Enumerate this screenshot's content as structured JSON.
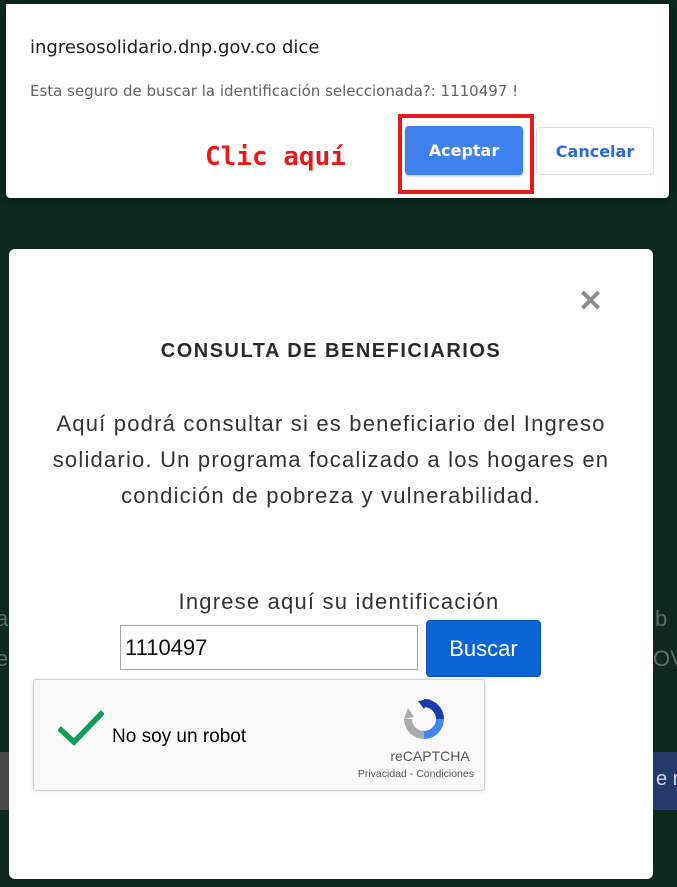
{
  "background": {
    "left_fragment_1": "a",
    "left_fragment_2": "e",
    "right_fragment_1": "b",
    "right_fragment_2": "OV",
    "right_bar_fragment": "e r"
  },
  "alert": {
    "title": "ingresosolidario.dnp.gov.co dice",
    "message": "Esta seguro de buscar la identificación seleccionada?: 1110497 !",
    "annotation": "Clic aquí",
    "accept_label": "Aceptar",
    "cancel_label": "Cancelar",
    "colors": {
      "accept": "#3f82ee",
      "annotation": "#e41b1b"
    }
  },
  "modal": {
    "close_icon": "close-icon",
    "title": "CONSULTA DE BENEFICIARIOS",
    "description": "Aquí podrá consultar si es beneficiario del Ingreso solidario. Un programa focalizado a los hogares en condición de pobreza y vulnerabilidad.",
    "id_label": "Ingrese aquí su identificación",
    "id_value": "1110497",
    "search_label": "Buscar",
    "colors": {
      "search_button": "#0b63d6"
    }
  },
  "captcha": {
    "label": "No soy un robot",
    "brand": "reCAPTCHA",
    "links": "Privacidad - Condiciones",
    "checked": true,
    "icons": {
      "check": "check-icon",
      "logo": "recaptcha-logo-icon"
    }
  }
}
